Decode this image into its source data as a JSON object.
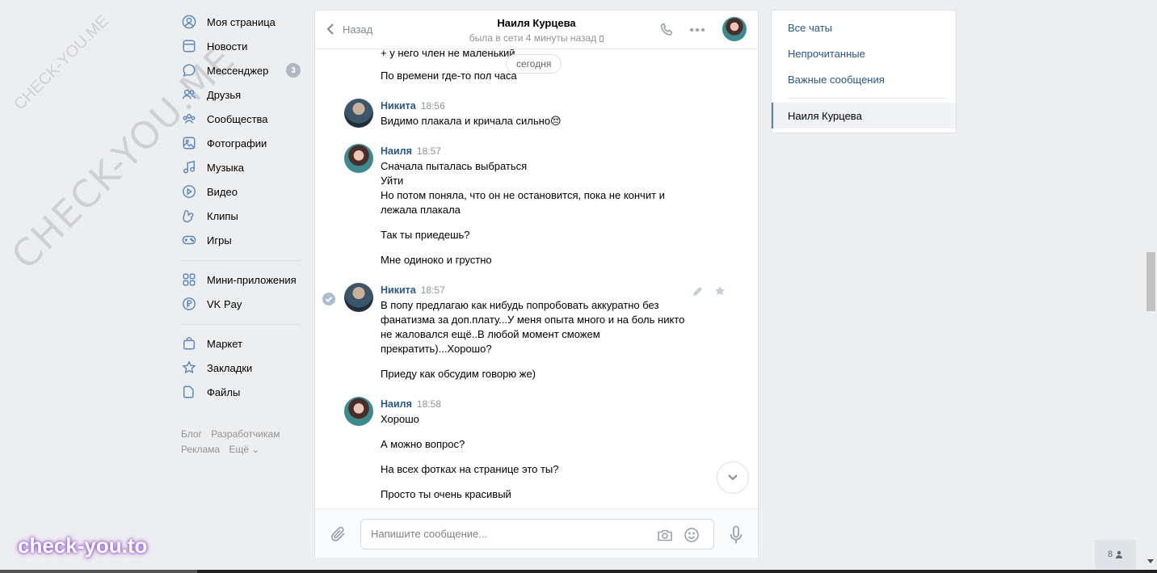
{
  "watermark": {
    "diagonal": "CHECK-YOU.ME",
    "small": "CHECK-YOU.ME",
    "bottom": "check-you.to"
  },
  "leftnav": {
    "items": [
      {
        "label": "Моя страница",
        "icon": "user-circle-icon"
      },
      {
        "label": "Новости",
        "icon": "news-icon"
      },
      {
        "label": "Мессенджер",
        "icon": "message-icon",
        "count": "3"
      },
      {
        "label": "Друзья",
        "icon": "friends-icon"
      },
      {
        "label": "Сообщества",
        "icon": "communities-icon"
      },
      {
        "label": "Фотографии",
        "icon": "photo-icon"
      },
      {
        "label": "Музыка",
        "icon": "music-icon"
      },
      {
        "label": "Видео",
        "icon": "video-icon"
      },
      {
        "label": "Клипы",
        "icon": "clips-icon"
      },
      {
        "label": "Игры",
        "icon": "gamepad-icon"
      }
    ],
    "items2": [
      {
        "label": "Мини-приложения",
        "icon": "apps-icon"
      },
      {
        "label": "VK Pay",
        "icon": "ruble-icon"
      }
    ],
    "items3": [
      {
        "label": "Маркет",
        "icon": "bag-icon"
      },
      {
        "label": "Закладки",
        "icon": "star-icon"
      },
      {
        "label": "Файлы",
        "icon": "file-icon"
      }
    ],
    "footer": {
      "blog": "Блог",
      "dev": "Разработчикам",
      "ads": "Реклама",
      "more": "Ещё ⌄"
    }
  },
  "chat": {
    "back_label": "Назад",
    "peer_name": "Наиля Курцева",
    "peer_status": "была в сети 4 минуты назад",
    "date_pill": "сегодня",
    "composer_placeholder": "Напишите сообщение...",
    "messages": {
      "pre1": "+ у него член не маленький",
      "pre2": "По времени где-то пол часа",
      "m1_author": "Никита",
      "m1_time": "18:56",
      "m1_t1": "Видимо плакала и кричала сильно😔",
      "m2_author": "Наиля",
      "m2_time": "18:57",
      "m2_t1": "Сначала пыталась выбраться",
      "m2_t2": "Уйти",
      "m2_t3": "Но потом поняла, что он не остановится, пока не кончит и лежала плакала",
      "m2_t4": "Так ты приедешь?",
      "m2_t5": "Мне одиноко и грустно",
      "m3_author": "Никита",
      "m3_time": "18:57",
      "m3_t1": "В попу предлагаю как нибудь попробовать аккуратно без фанатизма за доп.плату...У меня опыта много и на боль никто не жаловался ещё..В любой момент сможем прекратить)...Хорошо?",
      "m3_t2": "Приеду как обсудим говорю же)",
      "m4_author": "Наиля",
      "m4_time": "18:58",
      "m4_t1": "Хорошо",
      "m4_t2": "А можно вопрос?",
      "m4_t3": "На всех фотках на странице это ты?",
      "m4_t4": "Просто ты очень красивый"
    }
  },
  "rightpanel": {
    "all_chats": "Все чаты",
    "unread": "Непрочитанные",
    "important": "Важные сообщения",
    "active_chat": "Наиля Курцева"
  },
  "online_count": "8",
  "colors": {
    "accent": "#2a5885",
    "icon": "#5b88bd",
    "background": "#edeef0"
  }
}
